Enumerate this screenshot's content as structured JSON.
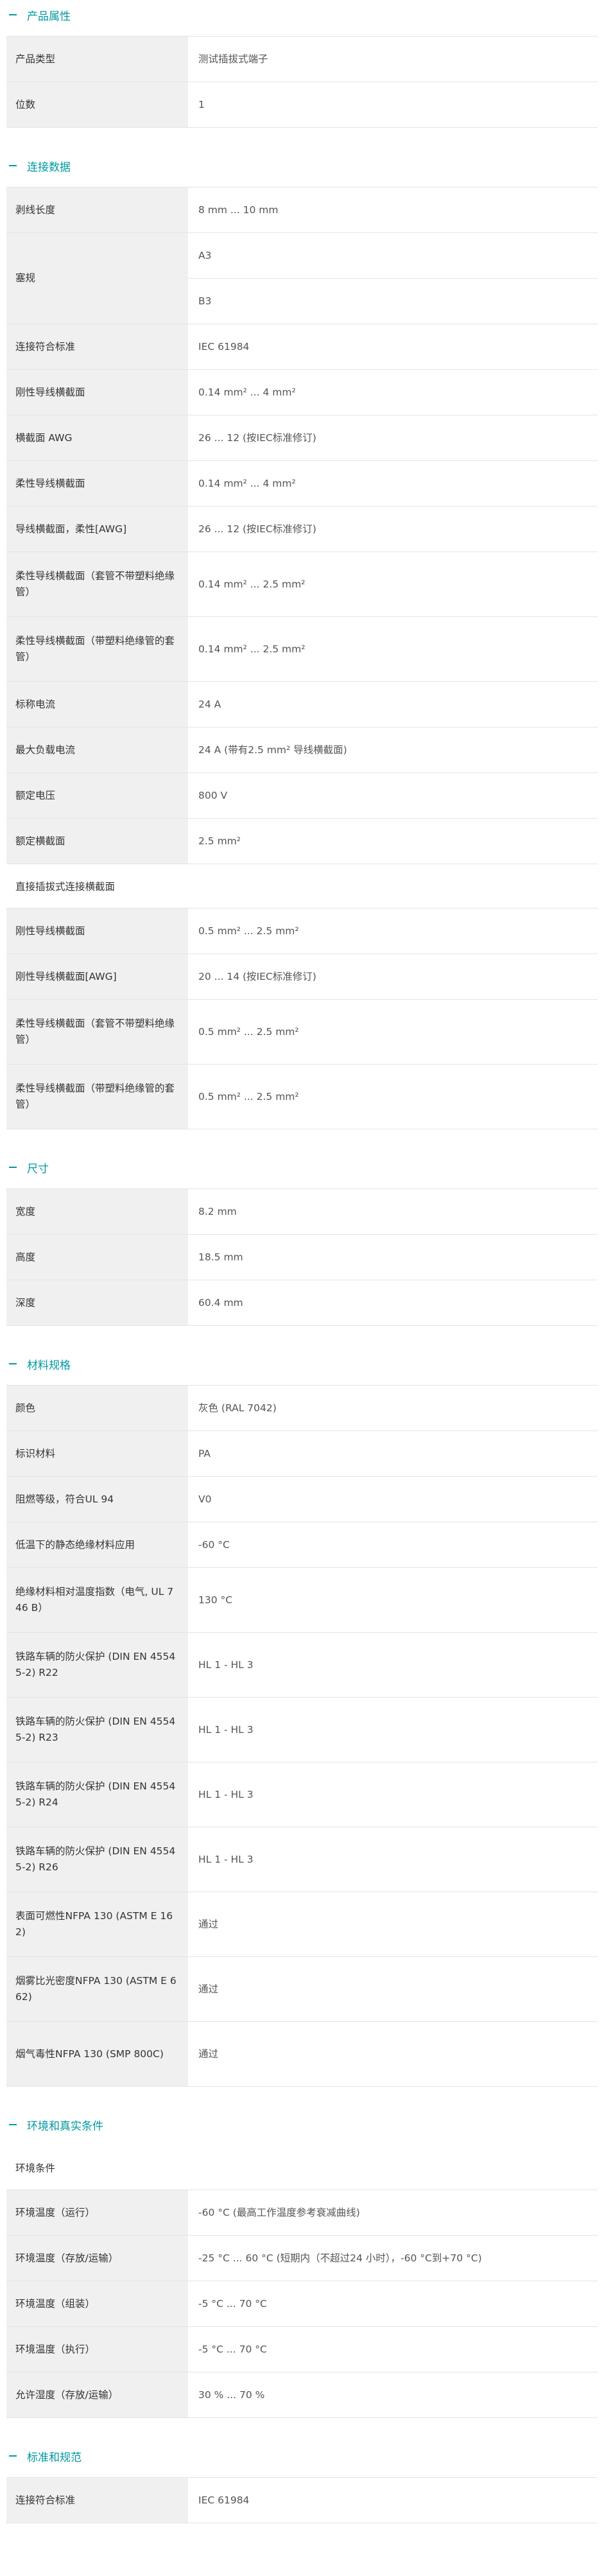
{
  "sections": [
    {
      "id": "product-attributes",
      "title": "产品属性",
      "blocks": [
        {
          "type": "table",
          "rows": [
            {
              "key": "产品类型",
              "values": [
                "测试插拔式端子"
              ]
            },
            {
              "key": "位数",
              "values": [
                "1"
              ]
            }
          ]
        }
      ]
    },
    {
      "id": "connection-data",
      "title": "连接数据",
      "blocks": [
        {
          "type": "table",
          "rows": [
            {
              "key": "剥线长度",
              "values": [
                "8 mm ... 10 mm"
              ]
            },
            {
              "key": "塞规",
              "values": [
                "A3",
                "B3"
              ]
            },
            {
              "key": "连接符合标准",
              "values": [
                "IEC 61984"
              ]
            },
            {
              "key": "刚性导线横截面",
              "values": [
                "0.14 mm² ... 4 mm²"
              ]
            },
            {
              "key": "横截面 AWG",
              "values": [
                "26 ... 12 (按IEC标准修订)"
              ]
            },
            {
              "key": "柔性导线横截面",
              "values": [
                "0.14 mm² ... 4 mm²"
              ]
            },
            {
              "key": "导线横截面，柔性[AWG]",
              "values": [
                "26 ... 12 (按IEC标准修订)"
              ]
            },
            {
              "key": "柔性导线横截面（套管不带塑料绝缘管）",
              "values": [
                "0.14 mm² ... 2.5 mm²"
              ]
            },
            {
              "key": "柔性导线横截面（带塑料绝缘管的套管）",
              "values": [
                "0.14 mm² ... 2.5 mm²"
              ]
            },
            {
              "key": "标称电流",
              "values": [
                "24 A"
              ]
            },
            {
              "key": "最大负载电流",
              "values": [
                "24 A (带有2.5 mm² 导线横截面)"
              ]
            },
            {
              "key": "额定电压",
              "values": [
                "800 V"
              ]
            },
            {
              "key": "额定横截面",
              "values": [
                "2.5 mm²"
              ]
            }
          ]
        },
        {
          "type": "subhead",
          "text": "直接插拔式连接横截面"
        },
        {
          "type": "table",
          "rows": [
            {
              "key": "刚性导线横截面",
              "values": [
                "0.5 mm² ... 2.5 mm²"
              ]
            },
            {
              "key": "刚性导线横截面[AWG]",
              "values": [
                "20 ... 14 (按IEC标准修订)"
              ]
            },
            {
              "key": "柔性导线横截面（套管不带塑料绝缘管）",
              "values": [
                "0.5 mm² ... 2.5 mm²"
              ]
            },
            {
              "key": "柔性导线横截面（带塑料绝缘管的套管）",
              "values": [
                "0.5 mm² ... 2.5 mm²"
              ]
            }
          ]
        }
      ]
    },
    {
      "id": "dimensions",
      "title": "尺寸",
      "blocks": [
        {
          "type": "table",
          "rows": [
            {
              "key": "宽度",
              "values": [
                "8.2 mm"
              ]
            },
            {
              "key": "高度",
              "values": [
                "18.5 mm"
              ]
            },
            {
              "key": "深度",
              "values": [
                "60.4 mm"
              ]
            }
          ]
        }
      ]
    },
    {
      "id": "material-specs",
      "title": "材料规格",
      "blocks": [
        {
          "type": "table",
          "rows": [
            {
              "key": "颜色",
              "values": [
                "灰色 (RAL 7042)"
              ]
            },
            {
              "key": "标识材料",
              "values": [
                "PA"
              ]
            },
            {
              "key": "阻燃等级，符合UL 94",
              "values": [
                "V0"
              ]
            },
            {
              "key": "低温下的静态绝缘材料应用",
              "values": [
                "-60 °C"
              ]
            },
            {
              "key": "绝缘材料相对温度指数（电气, UL 746 B）",
              "values": [
                "130 °C"
              ]
            },
            {
              "key": "铁路车辆的防火保护 (DIN EN 45545-2) R22",
              "values": [
                "HL 1 - HL 3"
              ]
            },
            {
              "key": "铁路车辆的防火保护 (DIN EN 45545-2) R23",
              "values": [
                "HL 1 - HL 3"
              ]
            },
            {
              "key": "铁路车辆的防火保护 (DIN EN 45545-2) R24",
              "values": [
                "HL 1 - HL 3"
              ]
            },
            {
              "key": "铁路车辆的防火保护 (DIN EN 45545-2) R26",
              "values": [
                "HL 1 - HL 3"
              ]
            },
            {
              "key": "表面可燃性NFPA 130 (ASTM E 162)",
              "values": [
                "通过"
              ]
            },
            {
              "key": "烟雾比光密度NFPA 130 (ASTM E 662)",
              "values": [
                "通过"
              ]
            },
            {
              "key": "烟气毒性NFPA 130 (SMP 800C)",
              "values": [
                "通过"
              ]
            }
          ]
        }
      ]
    },
    {
      "id": "environment",
      "title": "环境和真实条件",
      "blocks": [
        {
          "type": "subhead",
          "text": "环境条件"
        },
        {
          "type": "table",
          "rows": [
            {
              "key": "环境温度（运行）",
              "values": [
                "-60 °C (最高工作温度参考衰减曲线)"
              ]
            },
            {
              "key": "环境温度（存放/运输）",
              "values": [
                "-25 °C ... 60 °C (短期内（不超过24 小时），-60 °C到+70 °C)"
              ]
            },
            {
              "key": "环境温度（组装）",
              "values": [
                "-5 °C ... 70 °C"
              ]
            },
            {
              "key": "环境温度（执行）",
              "values": [
                "-5 °C ... 70 °C"
              ]
            },
            {
              "key": "允许湿度（存放/运输）",
              "values": [
                "30 % ... 70 %"
              ]
            }
          ]
        }
      ]
    },
    {
      "id": "standards",
      "title": "标准和规范",
      "blocks": [
        {
          "type": "table",
          "rows": [
            {
              "key": "连接符合标准",
              "values": [
                "IEC 61984"
              ]
            }
          ]
        }
      ]
    }
  ]
}
